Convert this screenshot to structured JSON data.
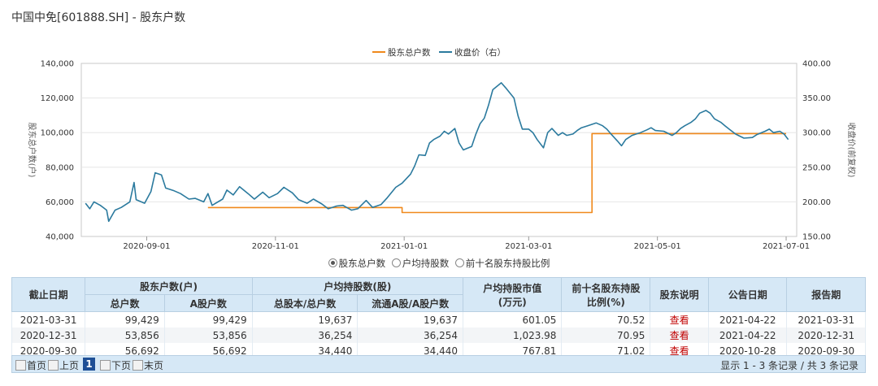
{
  "page": {
    "title": "中国中免[601888.SH] - 股东户数"
  },
  "chart_data": {
    "type": "line",
    "legend": [
      "股东总户数",
      "收盘价（右）"
    ],
    "ylabel_left": "股东总户数(户)",
    "ylabel_right": "收盘价(前复权)",
    "yleft_ticks": [
      "40,000",
      "60,000",
      "80,000",
      "100,000",
      "120,000",
      "140,000"
    ],
    "yright_ticks": [
      "150.00",
      "200.00",
      "250.00",
      "300.00",
      "350.00",
      "400.00"
    ],
    "yleft_range": [
      40000,
      140000
    ],
    "yright_range": [
      150,
      400
    ],
    "x_ticks": [
      "2020-09-01",
      "2020-11-01",
      "2021-01-01",
      "2021-03-01",
      "2021-05-01",
      "2021-07-01"
    ],
    "x_range": [
      "2020-08-01",
      "2021-07-06"
    ],
    "colors": {
      "holders": "#f0891c",
      "price": "#2b7a9e"
    },
    "series": [
      {
        "name": "股东总户数",
        "axis": "left",
        "points": [
          [
            "2020-09-30",
            56692
          ],
          [
            "2020-12-31",
            56692
          ],
          [
            "2020-12-31",
            53856
          ],
          [
            "2021-03-31",
            53856
          ],
          [
            "2021-03-31",
            99429
          ],
          [
            "2021-07-01",
            99429
          ]
        ]
      },
      {
        "name": "收盘价（右）",
        "axis": "right",
        "points": [
          [
            "2020-08-03",
            198
          ],
          [
            "2020-08-05",
            190
          ],
          [
            "2020-08-07",
            200
          ],
          [
            "2020-08-10",
            195
          ],
          [
            "2020-08-13",
            188
          ],
          [
            "2020-08-14",
            172
          ],
          [
            "2020-08-17",
            188
          ],
          [
            "2020-08-20",
            192
          ],
          [
            "2020-08-24",
            200
          ],
          [
            "2020-08-26",
            228
          ],
          [
            "2020-08-27",
            203
          ],
          [
            "2020-08-31",
            198
          ],
          [
            "2020-09-03",
            215
          ],
          [
            "2020-09-05",
            242
          ],
          [
            "2020-09-08",
            239
          ],
          [
            "2020-09-10",
            220
          ],
          [
            "2020-09-14",
            216
          ],
          [
            "2020-09-17",
            212
          ],
          [
            "2020-09-21",
            204
          ],
          [
            "2020-09-24",
            205
          ],
          [
            "2020-09-28",
            200
          ],
          [
            "2020-09-30",
            212
          ],
          [
            "2020-10-02",
            195
          ],
          [
            "2020-10-07",
            204
          ],
          [
            "2020-10-09",
            217
          ],
          [
            "2020-10-12",
            210
          ],
          [
            "2020-10-15",
            222
          ],
          [
            "2020-10-19",
            212
          ],
          [
            "2020-10-22",
            204
          ],
          [
            "2020-10-26",
            214
          ],
          [
            "2020-10-29",
            206
          ],
          [
            "2020-11-02",
            212
          ],
          [
            "2020-11-05",
            221
          ],
          [
            "2020-11-09",
            213
          ],
          [
            "2020-11-12",
            203
          ],
          [
            "2020-11-16",
            198
          ],
          [
            "2020-11-19",
            204
          ],
          [
            "2020-11-23",
            197
          ],
          [
            "2020-11-26",
            190
          ],
          [
            "2020-11-30",
            194
          ],
          [
            "2020-12-03",
            195
          ],
          [
            "2020-12-07",
            188
          ],
          [
            "2020-12-10",
            190
          ],
          [
            "2020-12-14",
            202
          ],
          [
            "2020-12-17",
            192
          ],
          [
            "2020-12-21",
            196
          ],
          [
            "2020-12-24",
            206
          ],
          [
            "2020-12-28",
            221
          ],
          [
            "2020-12-31",
            227
          ],
          [
            "2021-01-04",
            240
          ],
          [
            "2021-01-06",
            252
          ],
          [
            "2021-01-08",
            268
          ],
          [
            "2021-01-11",
            267
          ],
          [
            "2021-01-13",
            285
          ],
          [
            "2021-01-15",
            290
          ],
          [
            "2021-01-18",
            295
          ],
          [
            "2021-01-20",
            302
          ],
          [
            "2021-01-22",
            298
          ],
          [
            "2021-01-25",
            306
          ],
          [
            "2021-01-27",
            285
          ],
          [
            "2021-01-29",
            275
          ],
          [
            "2021-02-02",
            280
          ],
          [
            "2021-02-04",
            298
          ],
          [
            "2021-02-06",
            313
          ],
          [
            "2021-02-08",
            321
          ],
          [
            "2021-02-10",
            340
          ],
          [
            "2021-02-12",
            362
          ],
          [
            "2021-02-16",
            372
          ],
          [
            "2021-02-18",
            365
          ],
          [
            "2021-02-22",
            350
          ],
          [
            "2021-02-24",
            324
          ],
          [
            "2021-02-26",
            305
          ],
          [
            "2021-03-01",
            305
          ],
          [
            "2021-03-03",
            300
          ],
          [
            "2021-03-05",
            290
          ],
          [
            "2021-03-08",
            278
          ],
          [
            "2021-03-10",
            300
          ],
          [
            "2021-03-12",
            306
          ],
          [
            "2021-03-15",
            296
          ],
          [
            "2021-03-17",
            300
          ],
          [
            "2021-03-19",
            296
          ],
          [
            "2021-03-22",
            298
          ],
          [
            "2021-03-24",
            303
          ],
          [
            "2021-03-26",
            307
          ],
          [
            "2021-03-29",
            310
          ],
          [
            "2021-03-31",
            312
          ],
          [
            "2021-04-02",
            314
          ],
          [
            "2021-04-05",
            310
          ],
          [
            "2021-04-07",
            305
          ],
          [
            "2021-04-09",
            298
          ],
          [
            "2021-04-12",
            288
          ],
          [
            "2021-04-14",
            281
          ],
          [
            "2021-04-16",
            290
          ],
          [
            "2021-04-19",
            296
          ],
          [
            "2021-04-21",
            298
          ],
          [
            "2021-04-23",
            300
          ],
          [
            "2021-04-26",
            304
          ],
          [
            "2021-04-28",
            307
          ],
          [
            "2021-04-30",
            303
          ],
          [
            "2021-05-04",
            302
          ],
          [
            "2021-05-06",
            299
          ],
          [
            "2021-05-08",
            296
          ],
          [
            "2021-05-10",
            300
          ],
          [
            "2021-05-12",
            306
          ],
          [
            "2021-05-14",
            310
          ],
          [
            "2021-05-17",
            315
          ],
          [
            "2021-05-19",
            320
          ],
          [
            "2021-05-21",
            328
          ],
          [
            "2021-05-24",
            332
          ],
          [
            "2021-05-26",
            328
          ],
          [
            "2021-05-28",
            320
          ],
          [
            "2021-05-31",
            315
          ],
          [
            "2021-06-02",
            310
          ],
          [
            "2021-06-04",
            305
          ],
          [
            "2021-06-07",
            298
          ],
          [
            "2021-06-09",
            295
          ],
          [
            "2021-06-11",
            292
          ],
          [
            "2021-06-15",
            293
          ],
          [
            "2021-06-17",
            297
          ],
          [
            "2021-06-21",
            302
          ],
          [
            "2021-06-23",
            305
          ],
          [
            "2021-06-25",
            300
          ],
          [
            "2021-06-28",
            302
          ],
          [
            "2021-06-30",
            298
          ],
          [
            "2021-07-02",
            290
          ]
        ]
      }
    ]
  },
  "radio_options": [
    {
      "label": "股东总户数",
      "checked": true
    },
    {
      "label": "户均持股数",
      "checked": false
    },
    {
      "label": "前十名股东持股比例",
      "checked": false
    }
  ],
  "table": {
    "headers": {
      "date": "截止日期",
      "holders": "股东户数(户)",
      "total": "总户数",
      "a_holders": "A股户数",
      "avg_shares": "户均持股数(股)",
      "avg_total": "总股本/总户数",
      "avg_float": "流通A股/A股户数",
      "avg_value": "户均持股市值",
      "avg_value_unit": "(万元)",
      "top10": "前十名股东持股",
      "top10_unit": "比例(%)",
      "note": "股东说明",
      "announce": "公告日期",
      "report": "报告期"
    },
    "rows": [
      {
        "date": "2021-03-31",
        "total": "99,429",
        "a_holders": "99,429",
        "avg_total": "19,637",
        "avg_float": "19,637",
        "avg_value": "601.05",
        "top10": "70.52",
        "note": "查看",
        "announce": "2021-04-22",
        "report": "2021-03-31"
      },
      {
        "date": "2020-12-31",
        "total": "53,856",
        "a_holders": "53,856",
        "avg_total": "36,254",
        "avg_float": "36,254",
        "avg_value": "1,023.98",
        "top10": "70.95",
        "note": "查看",
        "announce": "2021-04-22",
        "report": "2020-12-31"
      },
      {
        "date": "2020-09-30",
        "total": "56,692",
        "a_holders": "56,692",
        "avg_total": "34,440",
        "avg_float": "34,440",
        "avg_value": "767.81",
        "top10": "71.02",
        "note": "查看",
        "announce": "2020-10-28",
        "report": "2020-09-30"
      }
    ]
  },
  "pager": {
    "first": "首页",
    "prev": "上页",
    "current": "1",
    "next": "下页",
    "last": "末页",
    "info": "显示 1 - 3 条记录 / 共 3 条记录"
  }
}
